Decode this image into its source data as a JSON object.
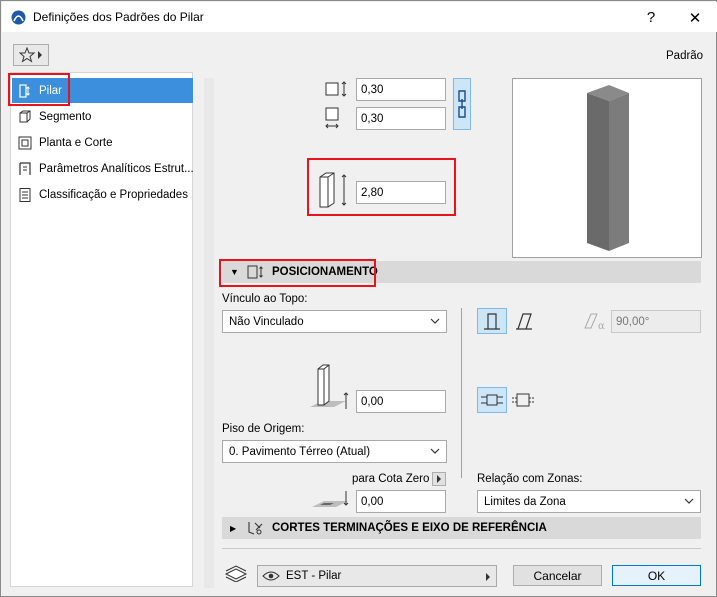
{
  "window": {
    "title": "Definições dos Padrões do Pilar",
    "help_label": "?",
    "close_label": "✕"
  },
  "header": {
    "favorites_icon": "star-icon",
    "preset_label": "Padrão"
  },
  "sidebar": {
    "items": [
      {
        "label": "Pilar",
        "icon": "column-icon",
        "selected": true
      },
      {
        "label": "Segmento",
        "icon": "segment-icon",
        "selected": false
      },
      {
        "label": "Planta e Corte",
        "icon": "floorplan-section-icon",
        "selected": false
      },
      {
        "label": "Parâmetros Analíticos Estrut...",
        "icon": "structural-analysis-icon",
        "selected": false
      },
      {
        "label": "Classificação e Propriedades",
        "icon": "classification-icon",
        "selected": false
      }
    ]
  },
  "dimensions": {
    "width_value": "0,30",
    "depth_value": "0,30",
    "height_value": "2,80"
  },
  "positioning": {
    "section_label": "POSICIONAMENTO",
    "top_link_label": "Vínculo ao Topo:",
    "top_link_value": "Não Vinculado",
    "angle_value": "90,00°",
    "top_offset_value": "0,00",
    "home_story_label": "Piso de Origem:",
    "home_story_value": "0. Pavimento Térreo (Atual)",
    "to_project_zero_label": "para Cota Zero",
    "elevation_value": "0,00",
    "zone_relation_label": "Relação com Zonas:",
    "zone_relation_value": "Limites da Zona"
  },
  "cuts_section": {
    "label": "CORTES TERMINAÇÕES E EIXO DE REFERÊNCIA"
  },
  "footer": {
    "layer_value": "EST - Pilar",
    "cancel_label": "Cancelar",
    "ok_label": "OK"
  },
  "colors": {
    "selection": "#3c8fdd",
    "highlight_box": "#e8141b",
    "toggle_active": "#cde6f7",
    "section_bar": "#d9d9d9"
  }
}
